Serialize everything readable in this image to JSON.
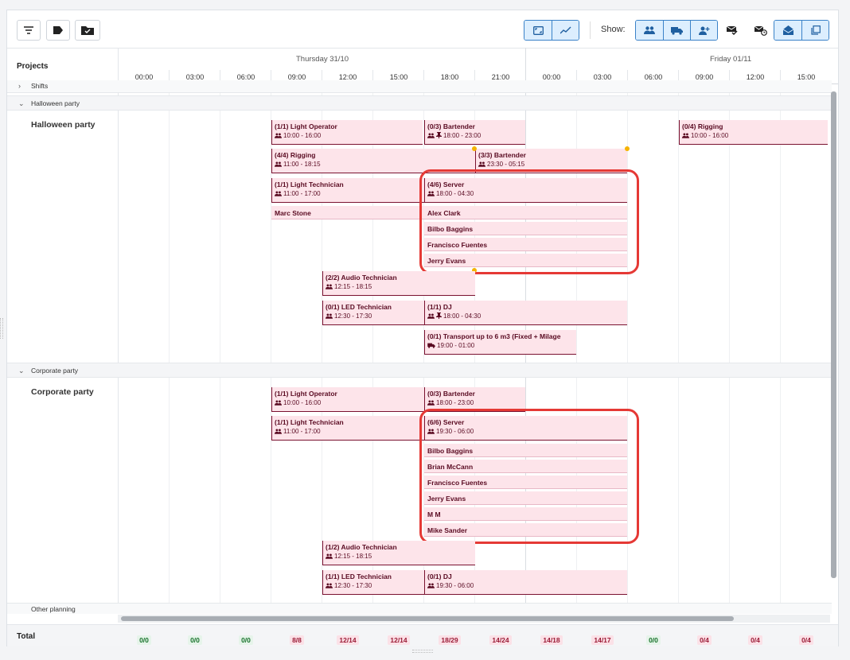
{
  "toolbar": {
    "show_label": "Show:"
  },
  "header": {
    "projects_title": "Projects",
    "days": [
      "Thursday 31/10",
      "Friday 01/11"
    ],
    "hours": [
      "00:00",
      "03:00",
      "06:00",
      "09:00",
      "12:00",
      "15:00",
      "18:00",
      "21:00",
      "00:00",
      "03:00",
      "06:00",
      "09:00",
      "12:00",
      "15:00"
    ]
  },
  "sections": {
    "shifts": "Shifts",
    "halloween": "Halloween party",
    "corporate": "Corporate party",
    "other": "Other planning"
  },
  "projects": {
    "halloween": "Halloween party",
    "corporate": "Corporate party"
  },
  "halloween_shifts": [
    {
      "title": "(1/1) Light Operator",
      "time": "10:00 - 16:00"
    },
    {
      "title": "(0/3) Bartender",
      "time": "18:00 - 23:00"
    },
    {
      "title": "(0/4) Rigging",
      "time": "10:00 - 16:00"
    },
    {
      "title": "(4/4) Rigging",
      "time": "11:00 - 18:15"
    },
    {
      "title": "(3/3) Bartender",
      "time": "23:30 - 05:15"
    },
    {
      "title": "(1/1) Light Technician",
      "time": "11:00 - 17:00"
    },
    {
      "title": "(4/6) Server",
      "time": "18:00 - 04:30"
    },
    {
      "title": "(2/2) Audio Technician",
      "time": "12:15 - 18:15"
    },
    {
      "title": "(0/1) LED Technician",
      "time": "12:30 - 17:30"
    },
    {
      "title": "(1/1) DJ",
      "time": "18:00 - 04:30"
    },
    {
      "title": "(0/1) Transport up to 6 m3 (Fixed + Milage",
      "time": "19:00 - 01:00"
    }
  ],
  "halloween_people": {
    "light_technician": [
      "Marc Stone"
    ],
    "server": [
      "Alex Clark",
      "Bilbo Baggins",
      "Francisco Fuentes",
      "Jerry Evans"
    ]
  },
  "corporate_shifts": [
    {
      "title": "(1/1) Light Operator",
      "time": "10:00 - 16:00"
    },
    {
      "title": "(0/3) Bartender",
      "time": "18:00 - 23:00"
    },
    {
      "title": "(1/1) Light Technician",
      "time": "11:00 - 17:00"
    },
    {
      "title": "(6/6) Server",
      "time": "19:30 - 06:00"
    },
    {
      "title": "(1/2) Audio Technician",
      "time": "12:15 - 18:15"
    },
    {
      "title": "(1/1) LED Technician",
      "time": "12:30 - 17:30"
    },
    {
      "title": "(0/1) DJ",
      "time": "19:30 - 06:00"
    }
  ],
  "corporate_people": {
    "server": [
      "Bilbo Baggins",
      "Brian McCann",
      "Francisco Fuentes",
      "Jerry Evans",
      "M M",
      "Mike Sander"
    ]
  },
  "totals": {
    "label": "Total",
    "values": [
      "0/0",
      "0/0",
      "0/0",
      "8/8",
      "12/14",
      "12/14",
      "18/29",
      "14/24",
      "14/18",
      "14/17",
      "0/0",
      "0/4",
      "0/4",
      "0/4"
    ],
    "status": [
      "ok",
      "ok",
      "ok",
      "bad",
      "bad",
      "bad",
      "bad",
      "bad",
      "bad",
      "bad",
      "ok",
      "bad",
      "bad",
      "bad"
    ]
  },
  "colors": {
    "shift_bg": "#fde4ea",
    "shift_text": "#5a0b22",
    "accent": "#3a82c8",
    "highlight": "#e53935"
  }
}
